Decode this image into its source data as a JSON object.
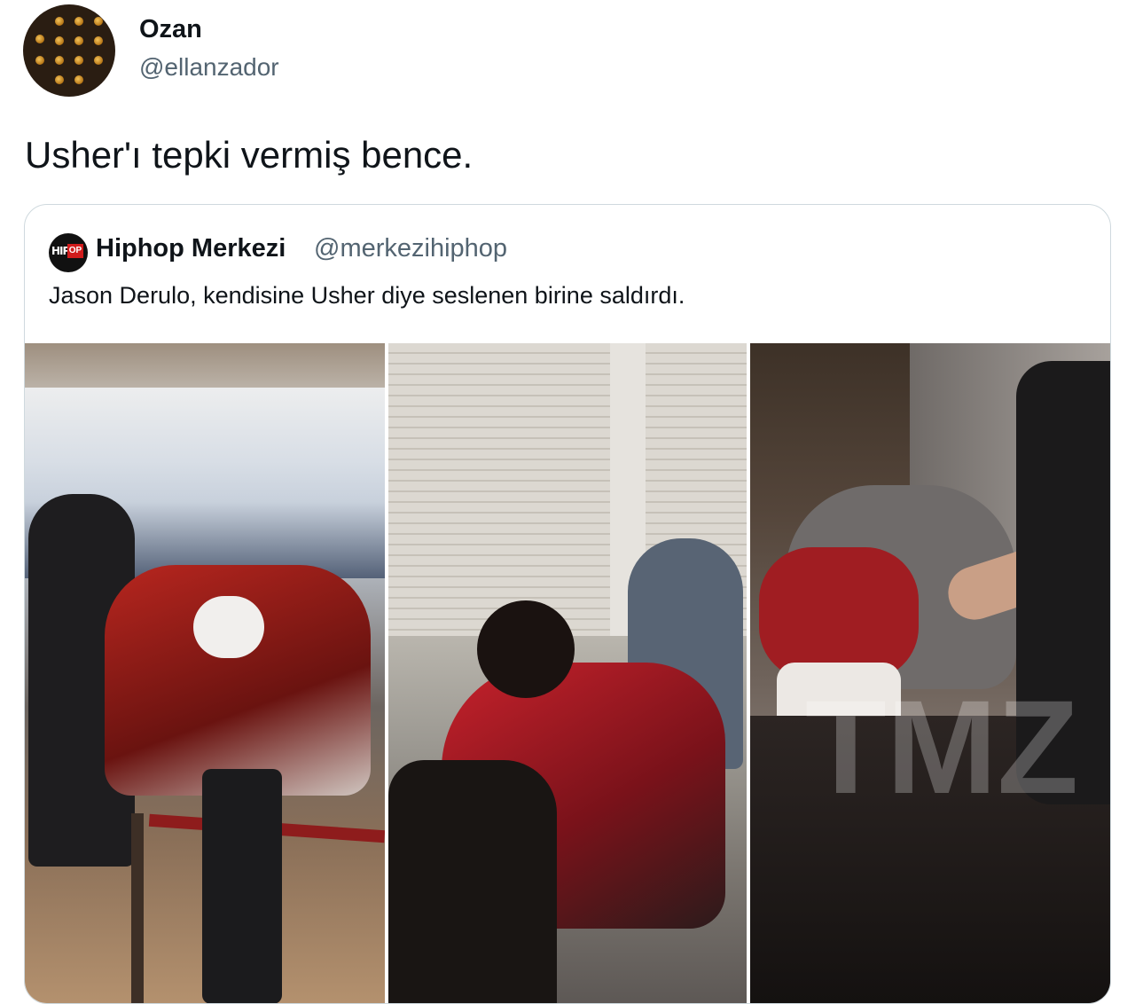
{
  "author": {
    "name": "Ozan",
    "handle": "@ellanzador"
  },
  "tweet": {
    "text": "Usher'ı tepki vermiş bence."
  },
  "quoted_tweet": {
    "name": "Hiphop Merkezi",
    "handle": "@merkezihiphop",
    "avatar_logo": "HIPHOP",
    "text": "Jason Derulo, kendisine Usher diye seslenen birine saldırdı."
  },
  "media": {
    "watermark": "TMZ",
    "panels": [
      {
        "id": "frame-1"
      },
      {
        "id": "frame-2"
      },
      {
        "id": "frame-3"
      }
    ]
  },
  "colors": {
    "text_primary": "#0f1419",
    "text_secondary": "#536471",
    "border": "#cfd9de",
    "accent_red": "#d11c1c"
  }
}
